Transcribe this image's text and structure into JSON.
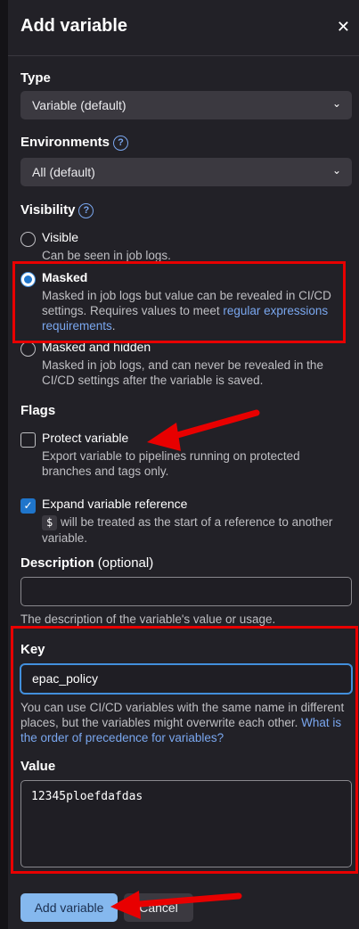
{
  "dialog": {
    "title": "Add variable",
    "close_icon": "close-icon"
  },
  "type": {
    "label": "Type",
    "value": "Variable (default)"
  },
  "environments": {
    "label": "Environments",
    "value": "All (default)"
  },
  "visibility": {
    "label": "Visibility",
    "options": [
      {
        "label": "Visible",
        "description": "Can be seen in job logs.",
        "selected": false
      },
      {
        "label": "Masked",
        "description": "Masked in job logs but value can be revealed in CI/CD settings. Requires values to meet ",
        "link": "regular expressions requirements",
        "suffix": ".",
        "selected": true
      },
      {
        "label": "Masked and hidden",
        "description": "Masked in job logs, and can never be revealed in the CI/CD settings after the variable is saved.",
        "selected": false
      }
    ]
  },
  "flags": {
    "label": "Flags",
    "protect": {
      "label": "Protect variable",
      "description": "Export variable to pipelines running on protected branches and tags only.",
      "checked": false
    },
    "expand": {
      "label": "Expand variable reference",
      "code": "$",
      "description": " will be treated as the start of a reference to another variable.",
      "checked": true
    }
  },
  "description": {
    "label": "Description",
    "optional": "(optional)",
    "value": "",
    "help": "The description of the variable's value or usage."
  },
  "key": {
    "label": "Key",
    "value": "epac_policy",
    "help": "You can use CI/CD variables with the same name in different places, but the variables might overwrite each other. ",
    "help_link": "What is the order of precedence for variables?"
  },
  "value_field": {
    "label": "Value",
    "value": "12345ploefdafdas"
  },
  "footer": {
    "add_label": "Add variable",
    "cancel_label": "Cancel"
  },
  "colors": {
    "annotation": "#e80000",
    "accent": "#1f75cb",
    "link": "#7aa7ef"
  }
}
